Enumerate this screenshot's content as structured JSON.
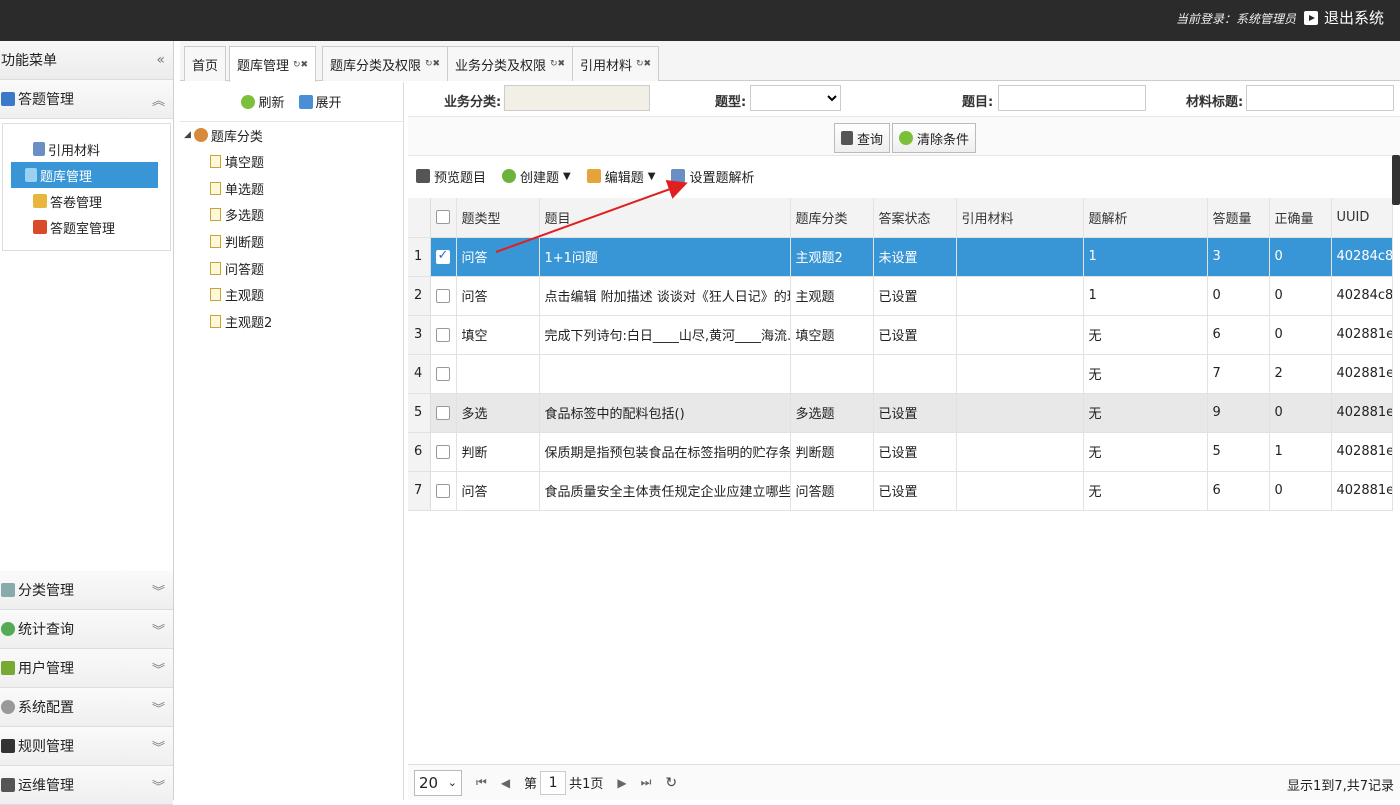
{
  "topbar": {
    "login_text": "当前登录：系统管理员",
    "logout_label": "退出系统"
  },
  "sidebar": {
    "title": "功能菜单",
    "collapse_icon": "«",
    "sections": [
      {
        "label": "答题管理",
        "chev": "︽"
      },
      {
        "label": "分类管理",
        "chev": "︾"
      },
      {
        "label": "统计查询",
        "chev": "︾"
      },
      {
        "label": "用户管理",
        "chev": "︾"
      },
      {
        "label": "系统配置",
        "chev": "︾"
      },
      {
        "label": "规则管理",
        "chev": "︾"
      },
      {
        "label": "运维管理",
        "chev": "︾"
      }
    ],
    "sub_items": [
      {
        "label": "引用材料"
      },
      {
        "label": "题库管理"
      },
      {
        "label": "答卷管理"
      },
      {
        "label": "答题室管理"
      }
    ]
  },
  "tabs": [
    {
      "label": "首页"
    },
    {
      "label": "题库管理"
    },
    {
      "label": "题库分类及权限"
    },
    {
      "label": "业务分类及权限"
    },
    {
      "label": "引用材料"
    }
  ],
  "tree": {
    "refresh_label": "刷新",
    "expand_label": "展开",
    "root_label": "题库分类",
    "nodes": [
      "填空题",
      "单选题",
      "多选题",
      "判断题",
      "问答题",
      "主观题",
      "主观题2"
    ]
  },
  "filter": {
    "business_label": "业务分类:",
    "type_label": "题型:",
    "question_label": "题目:",
    "material_label": "材料标题:",
    "query_btn": "查询",
    "clear_btn": "清除条件"
  },
  "toolbar": {
    "preview": "预览题目",
    "create": "创建题",
    "edit": "编辑题",
    "set_analysis": "设置题解析"
  },
  "table": {
    "headers": [
      "题类型",
      "题目",
      "题库分类",
      "答案状态",
      "引用材料",
      "题解析",
      "答题量",
      "正确量",
      "UUID"
    ],
    "rows": [
      {
        "n": "1",
        "type": "问答",
        "q": "1+1问题",
        "cat": "主观题2",
        "state": "未设置",
        "mat": "",
        "ana": "1",
        "cnt": "3",
        "ok": "0",
        "uuid": "40284c8"
      },
      {
        "n": "2",
        "type": "问答",
        "q": "点击编辑 附加描述 谈谈对《狂人日记》的理解",
        "cat": "主观题",
        "state": "已设置",
        "mat": "",
        "ana": "1",
        "cnt": "0",
        "ok": "0",
        "uuid": "40284c8"
      },
      {
        "n": "3",
        "type": "填空",
        "q": "完成下列诗句:白日____山尽,黄河____海流.",
        "cat": "填空题",
        "state": "已设置",
        "mat": "",
        "ana": "无",
        "cnt": "6",
        "ok": "0",
        "uuid": "402881e"
      },
      {
        "n": "4",
        "type": "",
        "q": "",
        "cat": "",
        "state": "",
        "mat": "",
        "ana": "无",
        "cnt": "7",
        "ok": "2",
        "uuid": "402881e"
      },
      {
        "n": "5",
        "type": "多选",
        "q": "食品标签中的配料包括()",
        "cat": "多选题",
        "state": "已设置",
        "mat": "",
        "ana": "无",
        "cnt": "9",
        "ok": "0",
        "uuid": "402881e"
      },
      {
        "n": "6",
        "type": "判断",
        "q": "保质期是指预包装食品在标签指明的贮存条件下",
        "cat": "判断题",
        "state": "已设置",
        "mat": "",
        "ana": "无",
        "cnt": "5",
        "ok": "1",
        "uuid": "402881e"
      },
      {
        "n": "7",
        "type": "问答",
        "q": "食品质量安全主体责任规定企业应建立哪些制度",
        "cat": "问答题",
        "state": "已设置",
        "mat": "",
        "ana": "无",
        "cnt": "6",
        "ok": "0",
        "uuid": "402881e"
      }
    ]
  },
  "pager": {
    "page_size": "20",
    "page_prefix": "第",
    "page_num": "1",
    "page_total": "共1页",
    "info": "显示1到7,共7记录"
  },
  "colors": {
    "accent": "#3996d6",
    "topbar": "#2b2b2b",
    "arrow": "#e02020"
  }
}
